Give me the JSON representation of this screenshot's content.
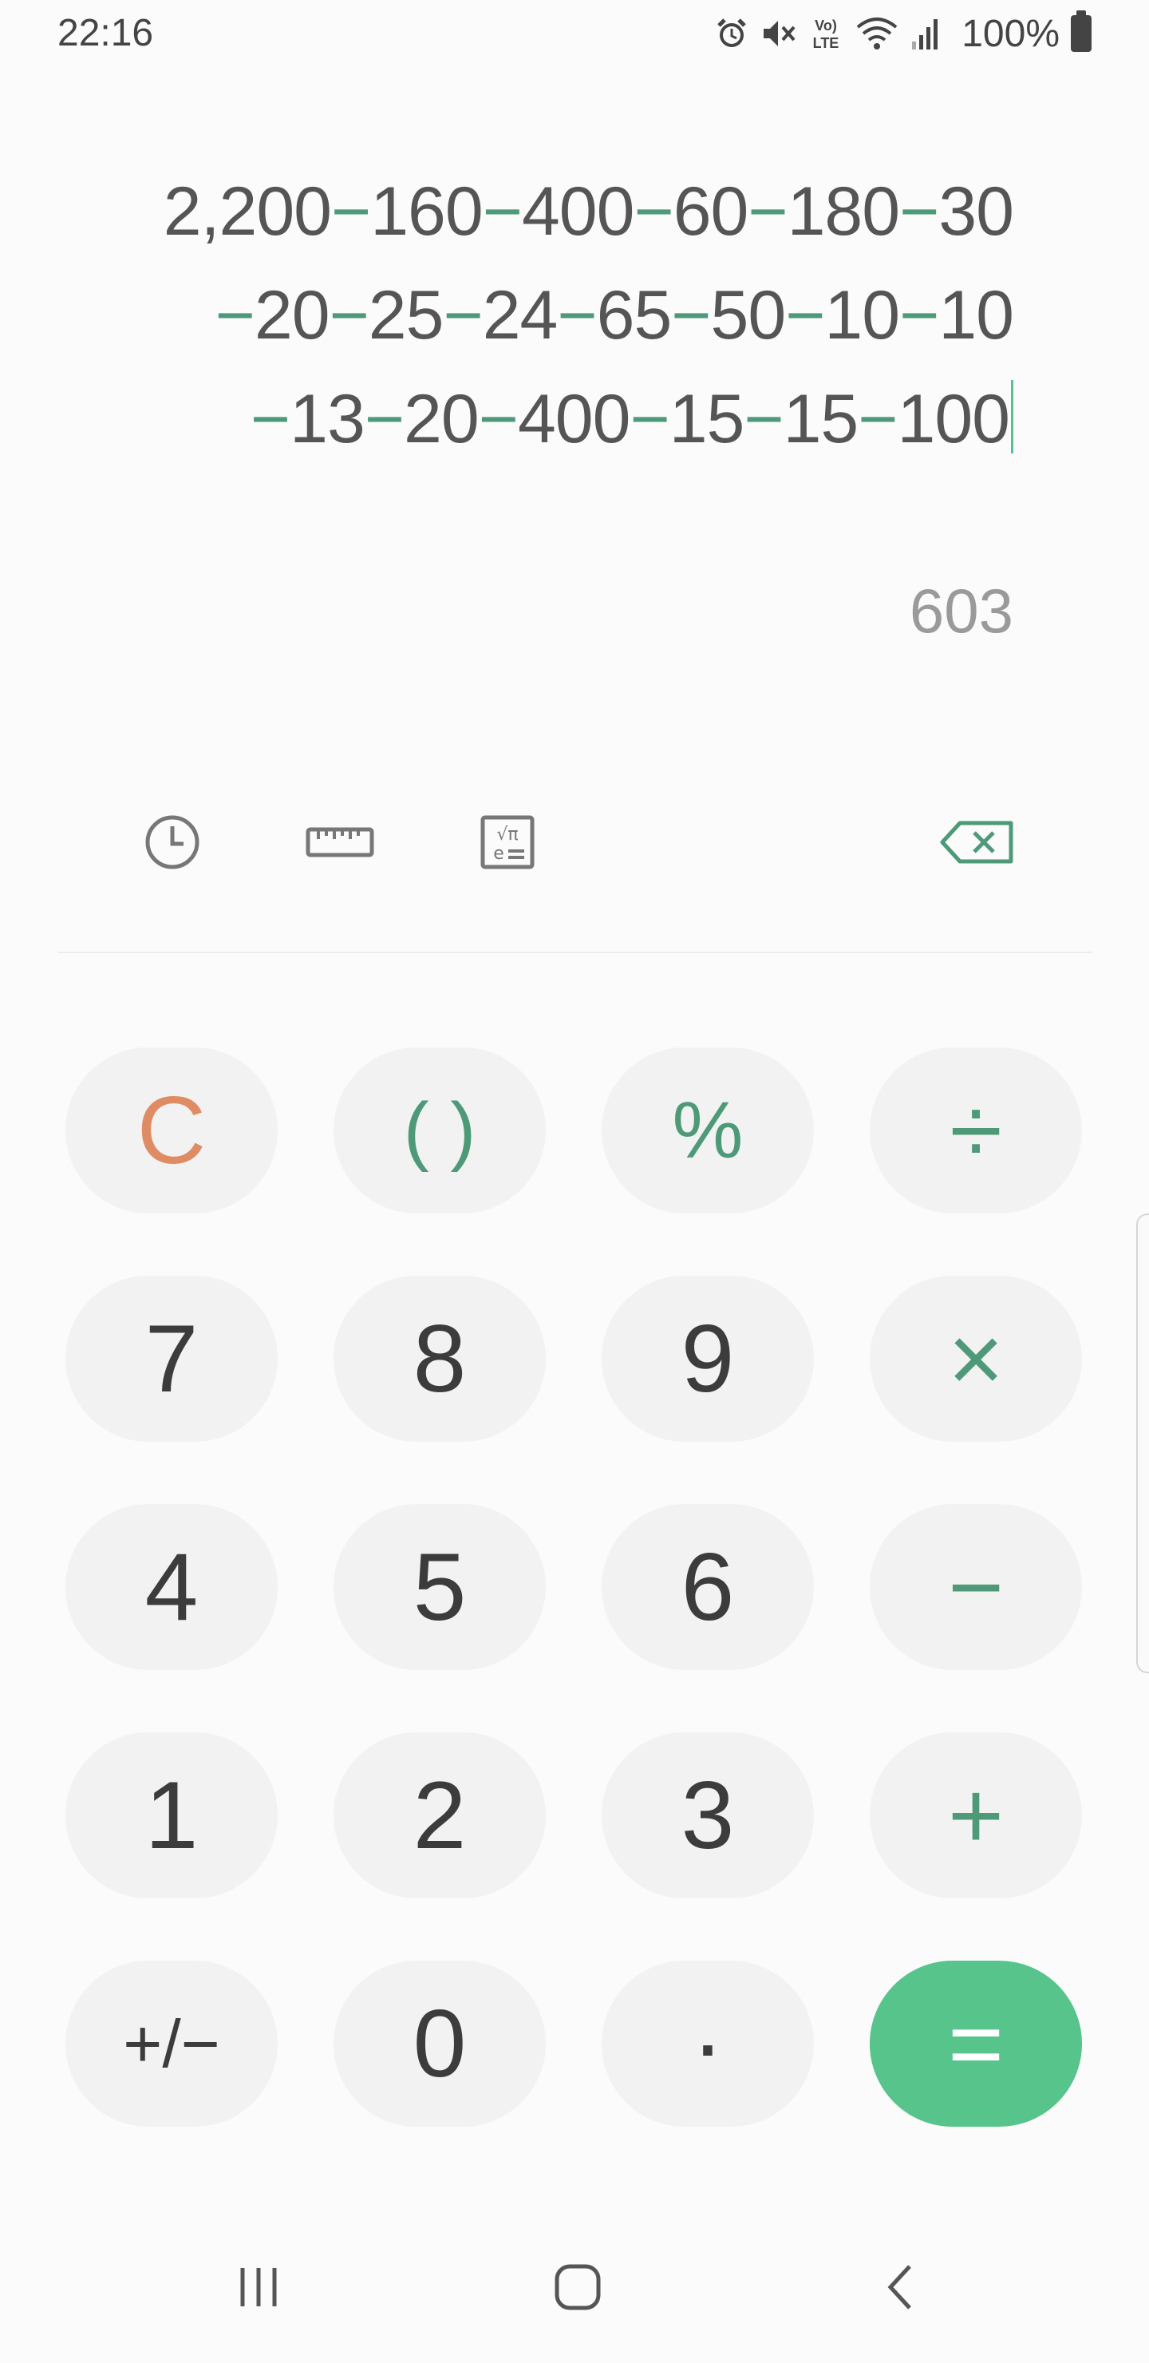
{
  "status": {
    "time": "22:16",
    "battery": "100%",
    "icons": [
      "alarm-icon",
      "mute-icon",
      "volte-icon",
      "wifi-icon",
      "signal-icon",
      "battery-icon"
    ]
  },
  "display": {
    "expression": [
      [
        "2,200",
        "−",
        "160",
        "−",
        "400",
        "−",
        "60",
        "−",
        "180",
        "−",
        "30"
      ],
      [
        "−",
        "20",
        "−",
        "25",
        "−",
        "24",
        "−",
        "65",
        "−",
        "50",
        "−",
        "10",
        "−",
        "10"
      ],
      [
        "−",
        "13",
        "−",
        "20",
        "−",
        "400",
        "−",
        "15",
        "−",
        "15",
        "−",
        "100"
      ]
    ],
    "result": "603"
  },
  "toolbar": {
    "icons": [
      "history-icon",
      "unit-converter-icon",
      "scientific-icon",
      "backspace-icon"
    ]
  },
  "keys": {
    "clear": "C",
    "parens": "( )",
    "percent": "%",
    "divide": "÷",
    "seven": "7",
    "eight": "8",
    "nine": "9",
    "multiply": "×",
    "four": "4",
    "five": "5",
    "six": "6",
    "minus": "−",
    "one": "1",
    "two": "2",
    "three": "3",
    "plus": "+",
    "sign": "+/−",
    "zero": "0",
    "dot": "·",
    "equals": "="
  },
  "colors": {
    "accent": "#56c48b",
    "operator": "#4e9a78",
    "clear": "#df8c65",
    "key_bg": "#f2f2f2"
  },
  "nav": {
    "icons": [
      "recents-icon",
      "home-icon",
      "back-icon"
    ]
  }
}
